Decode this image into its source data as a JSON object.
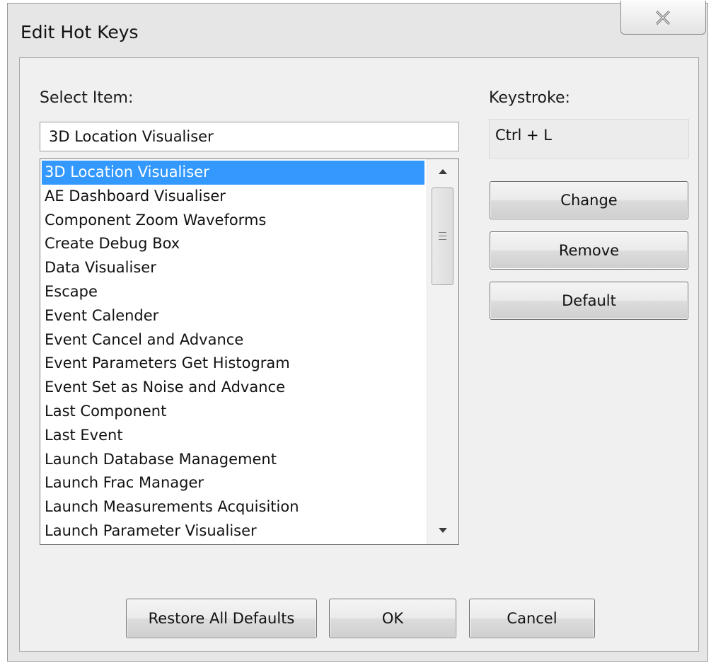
{
  "window": {
    "title": "Edit Hot Keys"
  },
  "select_item": {
    "label": "Select Item:",
    "input_value": "3D Location Visualiser"
  },
  "keystroke": {
    "label": "Keystroke:",
    "value": "Ctrl + L"
  },
  "list": {
    "selected_index": 0,
    "items": [
      "3D Location Visualiser",
      "AE Dashboard Visualiser",
      "Component Zoom Waveforms",
      "Create Debug Box",
      "Data Visualiser",
      "Escape",
      "Event Calender",
      "Event Cancel and Advance",
      "Event Parameters Get Histogram",
      "Event Set as Noise and Advance",
      "Last Component",
      "Last Event",
      "Launch Database Management",
      "Launch Frac Manager",
      "Launch Measurements Acquisition",
      "Launch Parameter Visualiser"
    ]
  },
  "buttons": {
    "change": "Change",
    "remove": "Remove",
    "default": "Default",
    "restore_all": "Restore All Defaults",
    "ok": "OK",
    "cancel": "Cancel"
  },
  "colors": {
    "selection": "#3399ff",
    "dialog_bg": "#f0f0f0"
  },
  "icons": {
    "close": "close-icon",
    "scroll_up": "arrow-up-icon",
    "scroll_down": "arrow-down-icon"
  }
}
